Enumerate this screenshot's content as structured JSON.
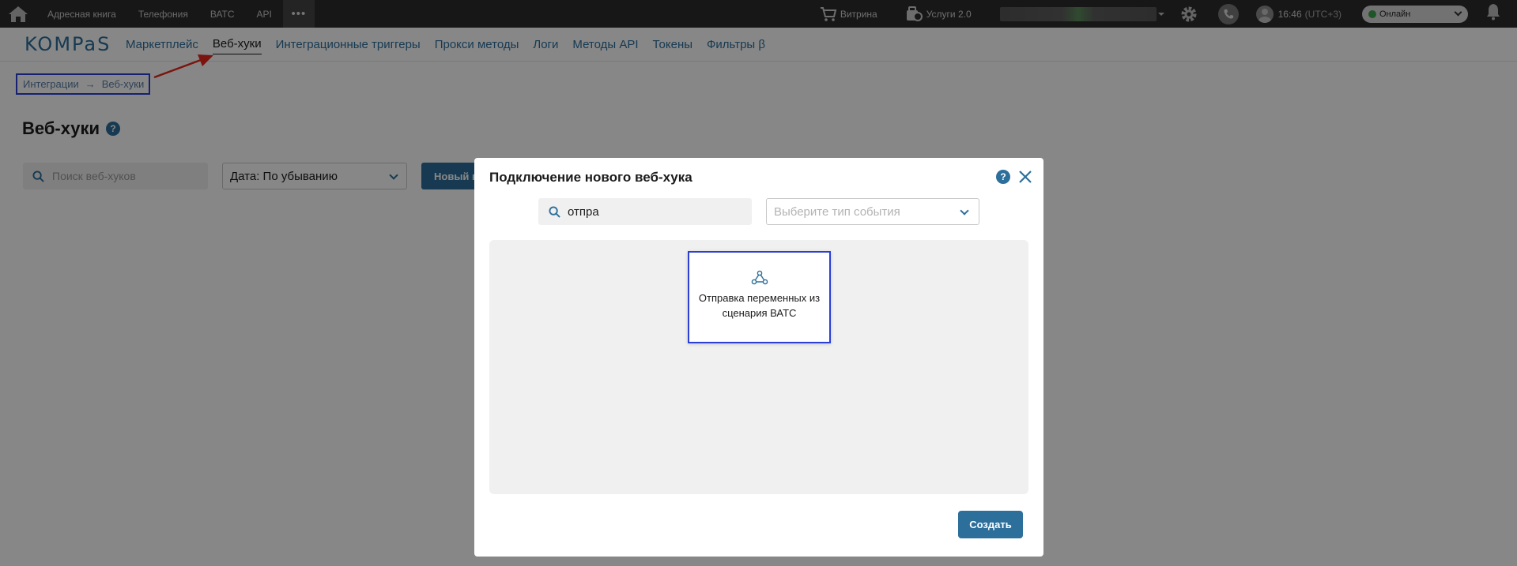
{
  "topbar": {
    "links": [
      "Адресная книга",
      "Телефония",
      "ВАТС",
      "API"
    ],
    "more_label": "•••",
    "showcase_label": "Витрина",
    "services_label": "Услуги 2.0",
    "time": "16:46",
    "timezone": "(UTC+3)",
    "status": "Онлайн",
    "status_color": "#3aa34a"
  },
  "nav": {
    "logo": "KOMPaS",
    "items": [
      "Маркетплейс",
      "Веб-хуки",
      "Интеграционные триггеры",
      "Прокси методы",
      "Логи",
      "Методы API",
      "Токены",
      "Фильтры β"
    ],
    "active_index": 1
  },
  "breadcrumb": {
    "items": [
      "Интеграции",
      "Веб-хуки"
    ],
    "separator": "→"
  },
  "page": {
    "title": "Веб-хуки",
    "help": "?",
    "search_placeholder": "Поиск веб-хуков",
    "sort_value": "Дата: По убыванию",
    "new_button": "Новый веб-хук"
  },
  "modal": {
    "title": "Подключение нового веб-хука",
    "help": "?",
    "search_value": "отпра",
    "event_type_placeholder": "Выберите тип события",
    "cards": [
      {
        "label": "Отправка переменных из сценария ВАТС",
        "icon": "webhook-icon"
      }
    ],
    "create_button": "Создать"
  },
  "colors": {
    "accent": "#2d6f9b",
    "highlight": "#2b3fd6",
    "annotation_arrow": "#e8261c",
    "topbar": "#2d2d2d"
  }
}
